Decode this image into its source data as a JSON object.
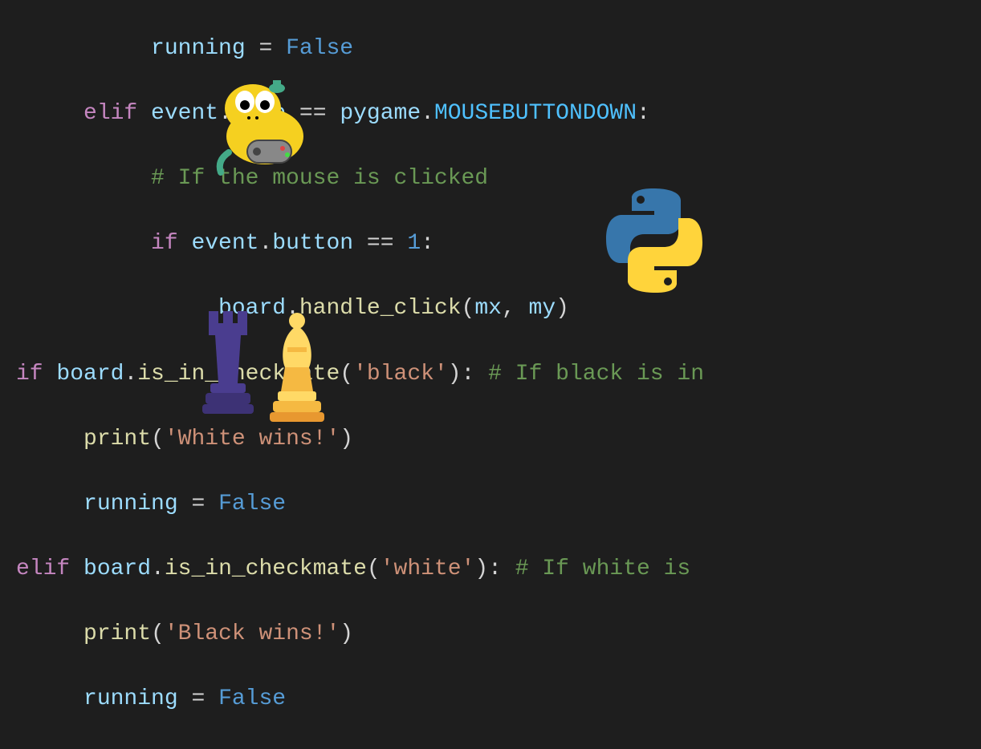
{
  "code": {
    "line1": {
      "var1": "running",
      "op": " = ",
      "val": "False"
    },
    "line2": {
      "kw": "elif",
      "var1": " event",
      "dot1": ".",
      "prop1": "type",
      "op": " == ",
      "var2": "pygame",
      "dot2": ".",
      "const": "MOUSEBUTTONDOWN",
      "colon": ":"
    },
    "line3": {
      "comment": "# If the mouse is clicked"
    },
    "line4": {
      "kw": "if",
      "var1": " event",
      "dot1": ".",
      "prop1": "button",
      "op": " == ",
      "num": "1",
      "colon": ":"
    },
    "line5": {
      "var1": "board",
      "dot1": ".",
      "fn": "handle_click",
      "paren1": "(",
      "arg1": "mx",
      "comma": ", ",
      "arg2": "my",
      "paren2": ")"
    },
    "line6": {
      "kw": "if",
      "var1": " board",
      "dot1": ".",
      "fn": "is_in_checkmate",
      "paren1": "(",
      "str": "'black'",
      "paren2": ")",
      "colon": ": ",
      "comment": "# If black is in"
    },
    "line7": {
      "fn": "print",
      "paren1": "(",
      "str": "'White wins!'",
      "paren2": ")"
    },
    "line8": {
      "var1": "running",
      "op": " = ",
      "val": "False"
    },
    "line9": {
      "kw": "elif",
      "var1": " board",
      "dot1": ".",
      "fn": "is_in_checkmate",
      "paren1": "(",
      "str": "'white'",
      "paren2": ")",
      "colon": ": ",
      "comment": "# If white is "
    },
    "line10": {
      "fn": "print",
      "paren1": "(",
      "str": "'Black wins!'",
      "paren2": ")"
    },
    "line11": {
      "var1": "running",
      "op": " = ",
      "val": "False"
    }
  }
}
